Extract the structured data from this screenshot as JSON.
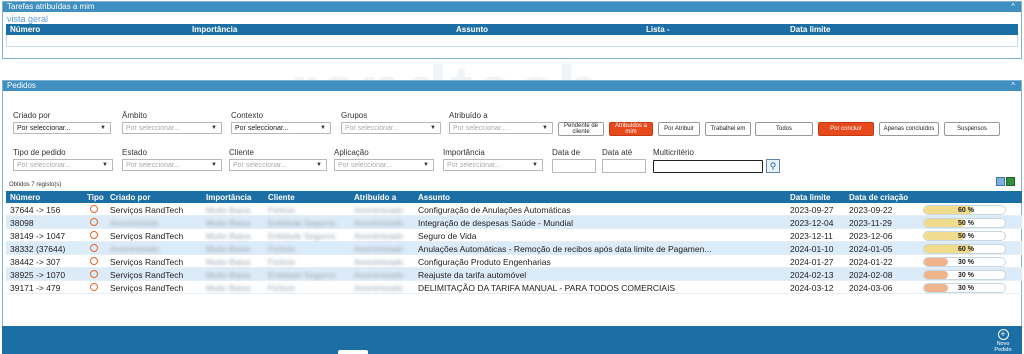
{
  "tasks": {
    "title": "Tarefas atribuídas a mim",
    "view_link": "vista geral",
    "columns": [
      "Número",
      "Importância",
      "Assunto",
      "Lista -",
      "Data limite"
    ]
  },
  "orders": {
    "title": "Pedidos",
    "filters_row1": [
      {
        "label": "Criado por",
        "value": "Por seleccionar..."
      },
      {
        "label": "Âmbito",
        "value": "Por seleccionar..."
      },
      {
        "label": "Contexto",
        "value": "Por seleccionar..."
      },
      {
        "label": "Grupos",
        "value": "Por seleccionar..."
      },
      {
        "label": "Atribuído a",
        "value": "Por seleccionar..."
      }
    ],
    "filters_row2": [
      {
        "label": "Tipo de pedido",
        "value": "Por seleccionar..."
      },
      {
        "label": "Estado",
        "value": "Por seleccionar..."
      },
      {
        "label": "Cliente",
        "value": "Por seleccionar..."
      },
      {
        "label": "Aplicação",
        "value": "Por seleccionar..."
      },
      {
        "label": "Importância",
        "value": "Por seleccionar..."
      }
    ],
    "date_from_label": "Data de",
    "date_to_label": "Data até",
    "multicriteria_label": "Multicritério",
    "buttons": {
      "pending_client": "Pendente de cliente",
      "assigned_to_me": "Atribuídos a mim",
      "to_assign": "Por Atribuir",
      "worked_on": "Trabalhei em",
      "all": "Todos",
      "to_conclude": "Por concluir",
      "only_concluded": "Apenas concluídos",
      "suspended": "Suspensos"
    },
    "count_text": "Obtidos 7 registo(s)",
    "columns": [
      "Número",
      "Tipo",
      "Criado por",
      "Importância",
      "Cliente",
      "Atribuído a",
      "Assunto",
      "Data limite",
      "Data de criação"
    ],
    "rows": [
      {
        "numero": "37644 -> 156",
        "criado": "Serviços RandTech",
        "importancia": "Muito Baixa",
        "cliente": "Fictício",
        "atribuido": "Anonimizado",
        "assunto": "Configuração de Anulações Automáticas",
        "limite": "2023-09-27",
        "criacao": "2023-09-22",
        "progress": 60
      },
      {
        "numero": "38098",
        "criado": "Anonimizado",
        "importancia": "Muito Baixa",
        "cliente": "Entidade Seguros",
        "atribuido": "Anonimizado",
        "assunto": "Integração de despesas Saúde - Mundial",
        "limite": "2023-12-04",
        "criacao": "2023-11-29",
        "progress": 50
      },
      {
        "numero": "38149 -> 1047",
        "criado": "Serviços RandTech",
        "importancia": "Muito Baixa",
        "cliente": "Entidade Seguros",
        "atribuido": "Anonimizado",
        "assunto": "Seguro de Vida",
        "limite": "2023-12-11",
        "criacao": "2023-12-06",
        "progress": 50
      },
      {
        "numero": "38332 (37644)",
        "criado": "Anonimizado",
        "importancia": "Muito Baixa",
        "cliente": "Fictício",
        "atribuido": "Anonimizado",
        "assunto": "Anulações Automáticas - Remoção de recibos após data limite de Pagamen...",
        "limite": "2024-01-10",
        "criacao": "2024-01-05",
        "progress": 60
      },
      {
        "numero": "38442 -> 307",
        "criado": "Serviços RandTech",
        "importancia": "Muito Baixa",
        "cliente": "Fictício",
        "atribuido": "Anonimizado",
        "assunto": "Configuração Produto Engenharias",
        "limite": "2024-01-27",
        "criacao": "2024-01-22",
        "progress": 30
      },
      {
        "numero": "38925 -> 1070",
        "criado": "Serviços RandTech",
        "importancia": "Muito Baixa",
        "cliente": "Entidade Seguros",
        "atribuido": "Anonimizado",
        "assunto": "Reajuste da tarifa automóvel",
        "limite": "2024-02-13",
        "criacao": "2024-02-08",
        "progress": 30
      },
      {
        "numero": "39171 -> 479",
        "criado": "Serviços RandTech",
        "importancia": "Muito Baixa",
        "cliente": "Fictício",
        "atribuido": "Anonimizado",
        "assunto": "DELIMITAÇÃO DA TARIFA MANUAL - PARA TODOS COMERCIAIS",
        "limite": "2024-03-12",
        "criacao": "2024-03-06",
        "progress": 30
      }
    ],
    "new_order_label": "Novo Pedido"
  },
  "colors": {
    "header_blue": "#1c6fa5",
    "panel_blue": "#3f8fc0",
    "row_alt": "#dcebf8",
    "accent_orange": "#e5491c",
    "progress_high": "#f0dc8c",
    "progress_low": "#f0b48c"
  },
  "icons": {
    "tipo": "headset-icon",
    "search": "search-icon",
    "export": [
      "export-icon",
      "excel-icon"
    ],
    "new_order": "plus-circle-icon"
  }
}
